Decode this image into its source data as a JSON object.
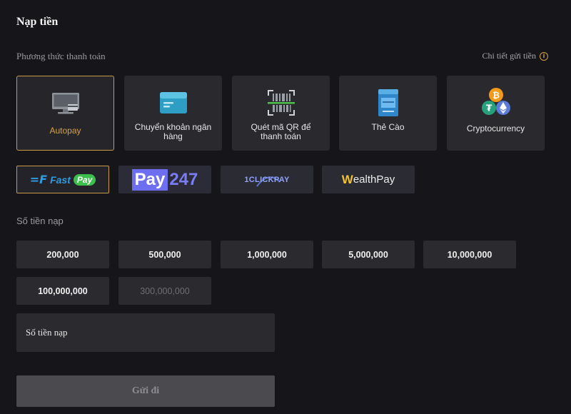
{
  "page": {
    "title": "Nạp tiền",
    "payment_method_label": "Phương thức thanh toán",
    "detail_link": "Chi tiết gửi tiền"
  },
  "methods": [
    {
      "label": "Autopay",
      "icon": "monitor-card-icon",
      "active": true
    },
    {
      "label": "Chuyển khoản ngân hàng",
      "icon": "bank-card-icon",
      "active": false
    },
    {
      "label": "Quét mã QR để thanh toán",
      "icon": "qr-scan-icon",
      "active": false
    },
    {
      "label": "Thẻ Cào",
      "icon": "scratch-card-icon",
      "active": false
    },
    {
      "label": "Cryptocurrency",
      "icon": "crypto-coins-icon",
      "active": false
    }
  ],
  "gateways": [
    {
      "name": "FastPay",
      "logo_text_1": "Fast",
      "logo_text_2": "Pay",
      "active": true
    },
    {
      "name": "Pay247",
      "logo_text_1": "Pay",
      "logo_text_2": "247",
      "active": false
    },
    {
      "name": "1ClickPay",
      "logo_text_1": "1CLICKPAY",
      "active": false
    },
    {
      "name": "WealthPay",
      "logo_text_1": "W",
      "logo_text_2": "ealthPay",
      "active": false
    }
  ],
  "amount": {
    "label": "Số tiền nạp",
    "options": [
      "200,000",
      "500,000",
      "1,000,000",
      "5,000,000",
      "10,000,000",
      "100,000,000",
      "300,000,000"
    ],
    "disabled_option": "300,000,000",
    "input_placeholder": "Số tiền nạp",
    "submit_label": "Gửi đi"
  },
  "colors": {
    "background": "#161519",
    "card": "#2a292e",
    "accent": "#c89b4b",
    "submit_disabled": "#4a4a4f"
  }
}
